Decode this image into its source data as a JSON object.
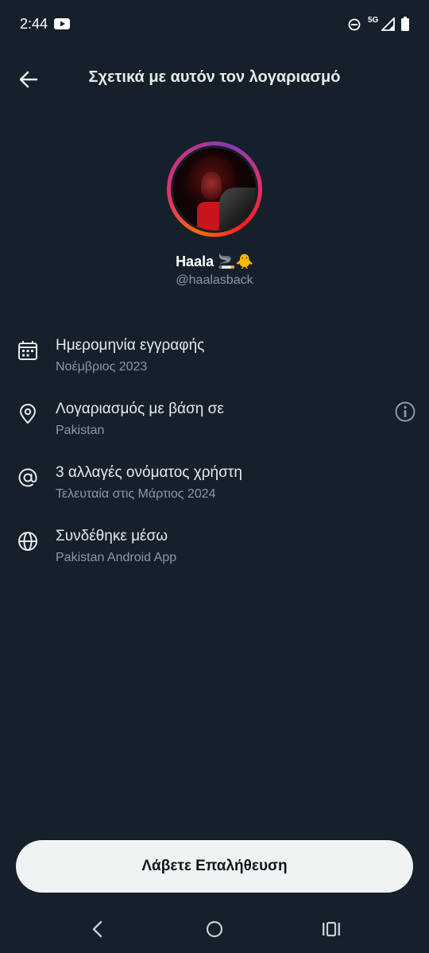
{
  "status_bar": {
    "time": "2:44",
    "network": "5G"
  },
  "header": {
    "title": "Σχετικά με αυτόν τον λογαριασμό"
  },
  "profile": {
    "display_name": "Haala 🚬🐥",
    "handle": "@haalasback"
  },
  "info_rows": [
    {
      "icon": "calendar-icon",
      "title": "Ημερομηνία εγγραφής",
      "subtitle": "Νοέμβριος 2023"
    },
    {
      "icon": "location-pin-icon",
      "title": "Λογαριασμός με βάση σε",
      "subtitle": "Pakistan"
    },
    {
      "icon": "at-sign-icon",
      "title": "3 αλλαγές ονόματος χρήστη",
      "subtitle": "Τελευταία στις Μάρτιος 2024"
    },
    {
      "icon": "globe-icon",
      "title": "Συνδέθηκε μέσω",
      "subtitle": "Pakistan Android App"
    }
  ],
  "verify_button": {
    "label": "Λάβετε Επαλήθευση"
  },
  "colors": {
    "background": "#15202b",
    "primary_text": "#e7e9ea",
    "secondary_text": "#8b98a5",
    "button_bg": "#eff3f4"
  }
}
